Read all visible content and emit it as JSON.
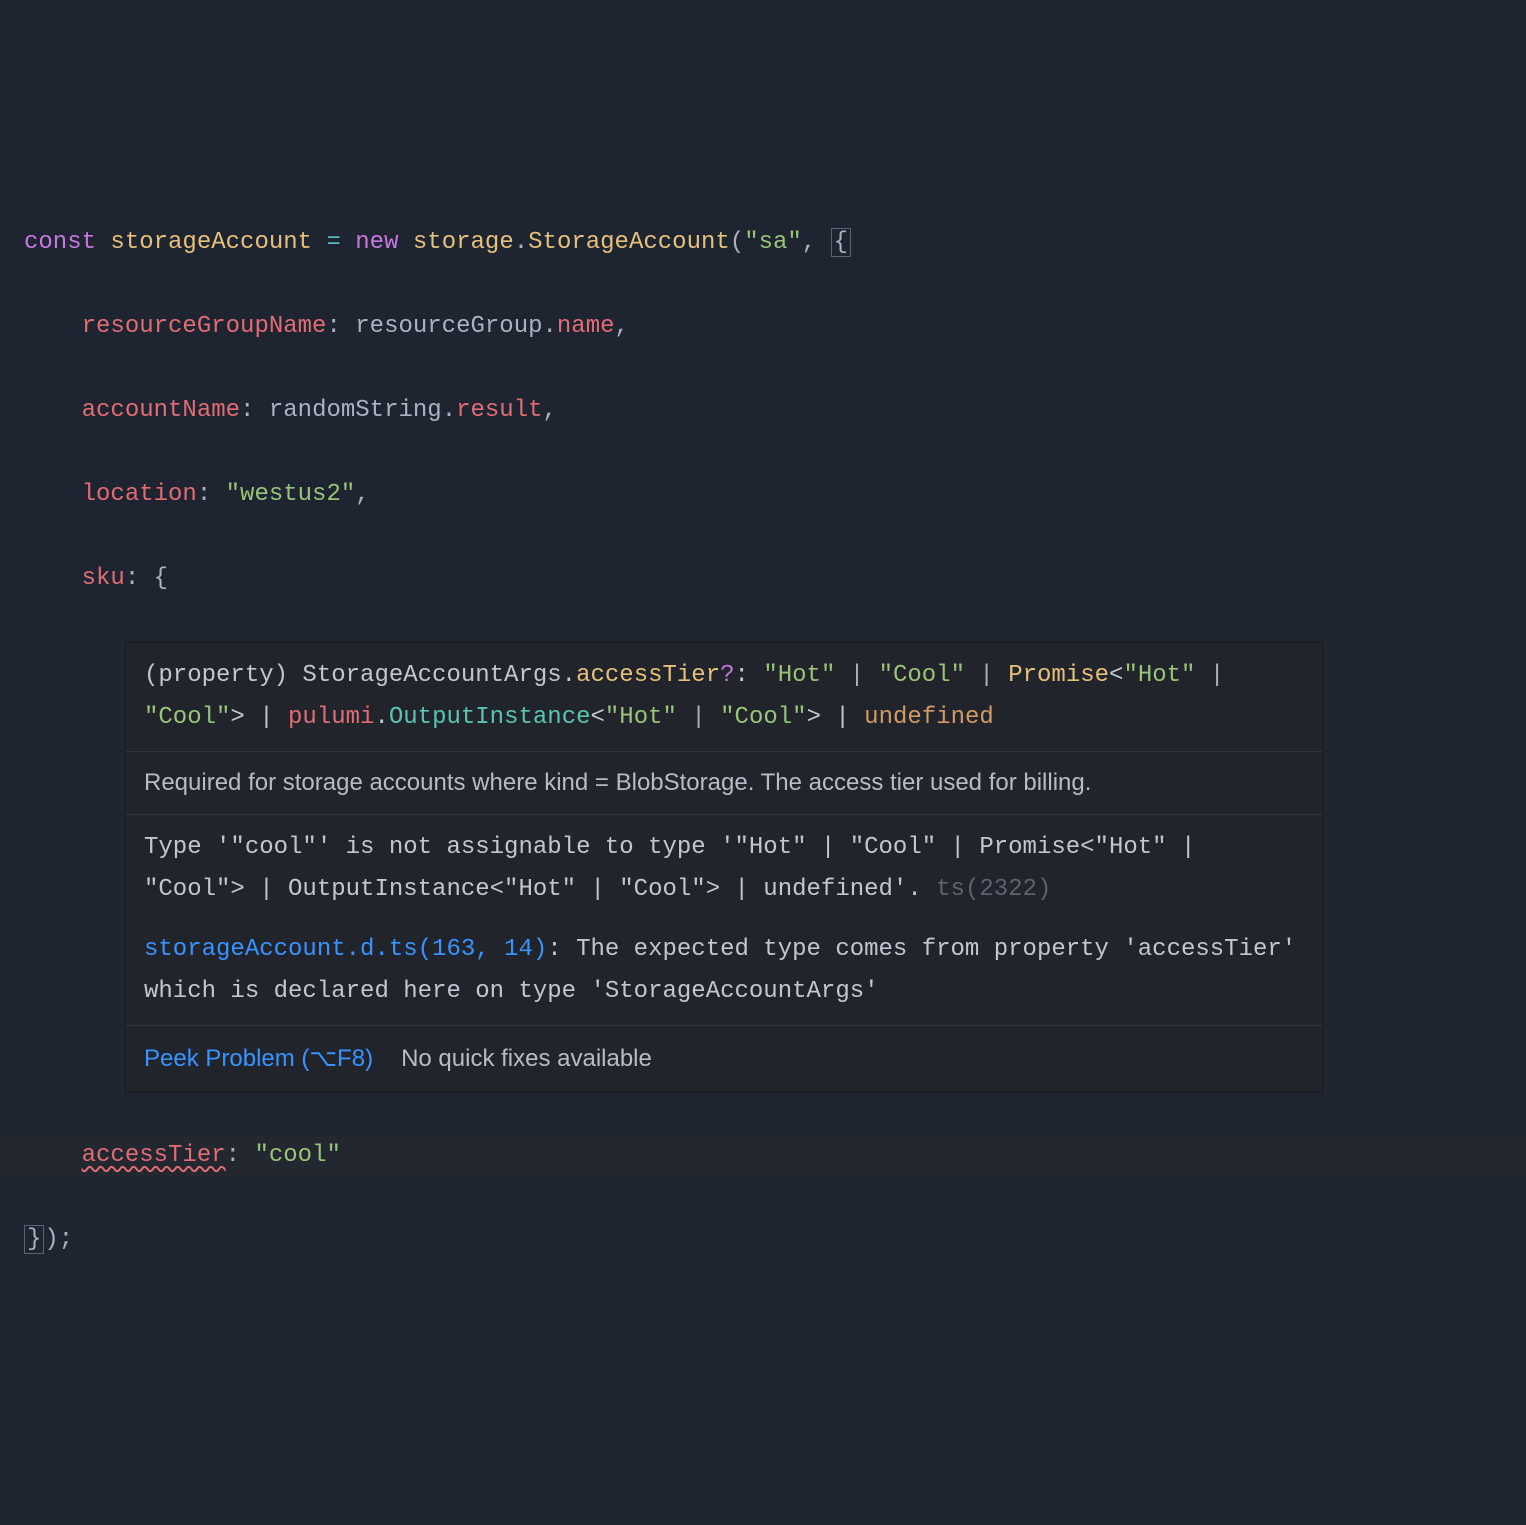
{
  "code": {
    "line1": {
      "const": "const",
      "varName": "storageAccount",
      "eq": "=",
      "new": "new",
      "ns": "storage",
      "cls": "StorageAccount",
      "strArg": "\"sa\""
    },
    "line2": {
      "prop": "resourceGroupName",
      "rhsObj": "resourceGroup",
      "rhsMember": "name"
    },
    "line3": {
      "prop": "accountName",
      "rhsObj": "randomString",
      "rhsMember": "result"
    },
    "line4": {
      "prop": "location",
      "val": "\"westus2\""
    },
    "line5": {
      "prop": "sku"
    },
    "line6": {
      "prop": "accessTier",
      "val": "\"cool\""
    }
  },
  "hover": {
    "signature": {
      "propertyLabel": "(property) StorageAccountArgs.",
      "propName": "accessTier",
      "opt": "?",
      "hot": "\"Hot\"",
      "cool": "\"Cool\"",
      "promise": "Promise",
      "pulumi": "pulumi",
      "outputInstance": "OutputInstance",
      "undefined": "undefined"
    },
    "doc": "Required for storage accounts where kind = BlobStorage. The access tier used for billing.",
    "error": {
      "msg1": "Type '\"cool\"' is not assignable to type '\"Hot\" | \"Cool\" | Promise<\"Hot\" | \"Cool\"> | OutputInstance<\"Hot\" | \"Cool\"> | undefined'.",
      "code": "ts(2322)",
      "related": {
        "file": "storageAccount.d.ts(163, 14)",
        "text": ": The expected type comes from property 'accessTier' which is declared here on type 'StorageAccountArgs'"
      }
    },
    "actions": {
      "peek": "Peek Problem (⌥F8)",
      "noquick": "No quick fixes available"
    }
  }
}
